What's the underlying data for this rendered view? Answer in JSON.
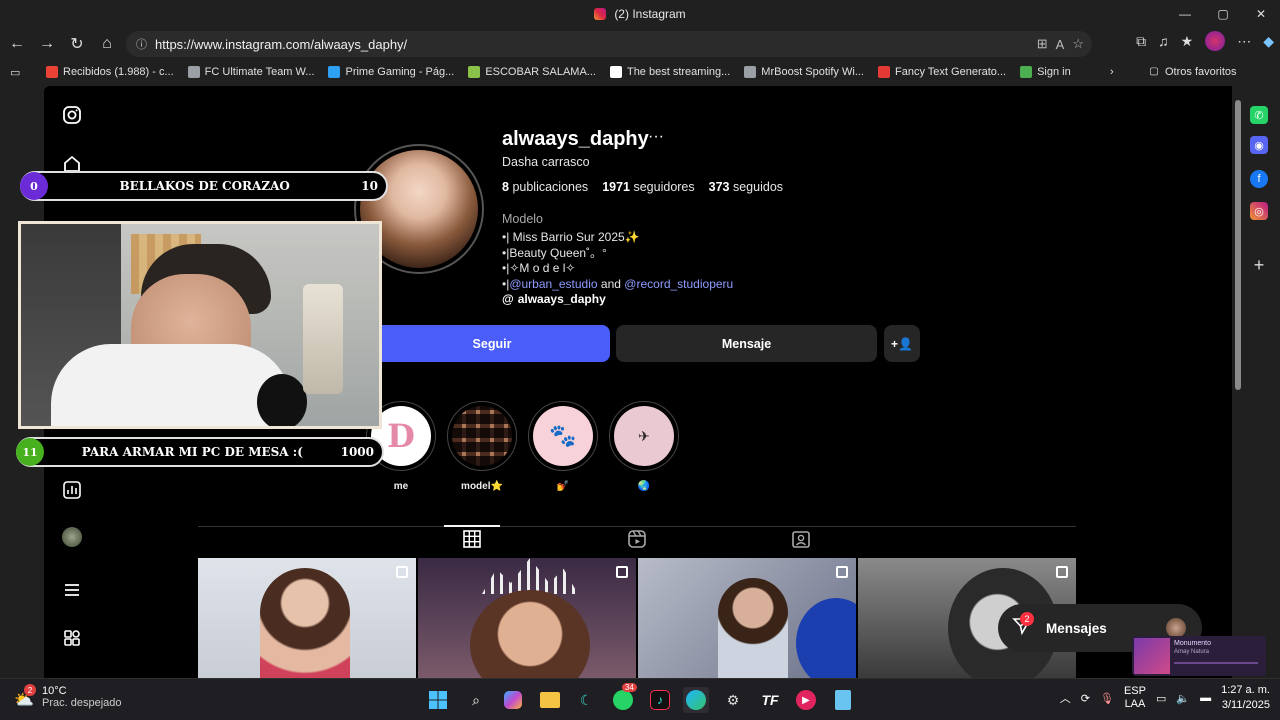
{
  "browser": {
    "tab_title": "(2) Instagram",
    "url": "https://www.instagram.com/alwaays_daphy/",
    "bookmarks": [
      {
        "label": "Recibidos (1.988) - c...",
        "icon": "gmail-icon",
        "color": "#ea4335"
      },
      {
        "label": "FC Ultimate Team W...",
        "icon": "globe-icon",
        "color": "#9aa0a6"
      },
      {
        "label": "Prime Gaming - Pág...",
        "icon": "crown-icon",
        "color": "#2ea1f5"
      },
      {
        "label": "ESCOBAR SALAMA...",
        "icon": "bookmark-icon",
        "color": "#8bc34a"
      },
      {
        "label": "The best streaming...",
        "icon": "diamond-icon",
        "color": "#ffffff"
      },
      {
        "label": "MrBoost Spotify Wi...",
        "icon": "globe-icon",
        "color": "#9aa0a6"
      },
      {
        "label": "Fancy Text Generato...",
        "icon": "fancy-text-icon",
        "color": "#e53935"
      },
      {
        "label": "Sign in",
        "icon": "sign-in-icon",
        "color": "#4caf50"
      }
    ],
    "other_favorites": "Otros favoritos"
  },
  "profile": {
    "username": "alwaays_daphy",
    "full_name": "Dasha carrasco",
    "stats": {
      "posts_count": "8",
      "posts_label": "publicaciones",
      "followers_count": "1971",
      "followers_label": "seguidores",
      "following_count": "373",
      "following_label": "seguidos"
    },
    "category": "Modelo",
    "bio_lines": [
      "•| Miss Barrio Sur 2025✨",
      "•|Beauty Queen˚。°",
      "•|✧M o d e l✧"
    ],
    "bio_tag_prefix": "•|",
    "bio_tag_1": "@urban_estudio",
    "bio_tag_and": "and",
    "bio_tag_2": "@record_studioperu",
    "threads_handle": "alwaays_daphy",
    "follow_button": "Seguir",
    "message_button": "Mensaje"
  },
  "highlights": [
    {
      "label": "me",
      "glyph": "D",
      "bg": "#ffffff",
      "fg": "#e48aa8"
    },
    {
      "label": "model⭐",
      "glyph": "",
      "bg": "#3a2a26",
      "fg": "#ffffff"
    },
    {
      "label": "💅",
      "glyph": "🐾",
      "bg": "#f7d2d9",
      "fg": "#ffffff"
    },
    {
      "label": "🌏",
      "glyph": "✈",
      "bg": "#ebc9d2",
      "fg": "#222222"
    }
  ],
  "messages_widget": {
    "label": "Mensajes",
    "badge": "2"
  },
  "stream_overlay": {
    "banner_top": {
      "left_number": "0",
      "title": "BELLAKOS DE CORAZAO",
      "right_number": "10",
      "circle_color": "#6b2bd6"
    },
    "banner_bottom": {
      "left_number": "11",
      "title": "PARA ARMAR MI PC DE MESA :(",
      "right_number": "1000",
      "circle_color": "#46b01f"
    }
  },
  "now_playing": {
    "title": "Monumento",
    "artist": "Amay Natura"
  },
  "taskbar": {
    "weather_temp": "10°C",
    "weather_cond": "Prac. despejado",
    "weather_badge": "2",
    "whatsapp_badge": "34",
    "lang_top": "ESP",
    "lang_bottom": "LAA",
    "time": "1:27 a. m.",
    "date": "3/11/2025"
  }
}
